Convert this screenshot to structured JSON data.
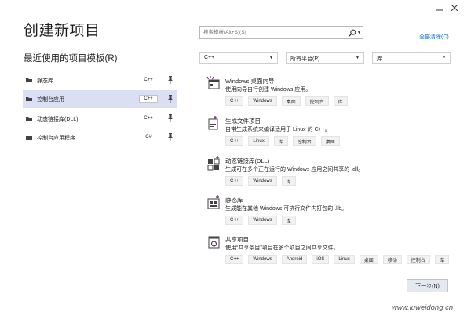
{
  "window": {
    "minimize_icon": "minimize-icon",
    "maximize_icon": "maximize-icon",
    "close_icon": "close-icon"
  },
  "page": {
    "title": "创建新项目"
  },
  "recent": {
    "title": "最近使用的项目模板(R)",
    "items": [
      {
        "name": "静态库",
        "lang": "C++",
        "selected": false,
        "pin_icon": "pin-icon"
      },
      {
        "name": "控制台应用",
        "lang": "C++",
        "selected": true,
        "pin_icon": "pin-icon"
      },
      {
        "name": "动态链接库(DLL)",
        "lang": "C++",
        "selected": false,
        "pin_icon": "pin-icon"
      },
      {
        "name": "控制台应用程序",
        "lang": "C#",
        "selected": false,
        "pin_icon": "pin-icon"
      }
    ]
  },
  "search": {
    "placeholder": "搜索模板(Alt+S)(S)",
    "value": "",
    "icon": "search-icon"
  },
  "clear_all": "全部清除(C)",
  "filters": {
    "language": "C++",
    "platform": "所有平台(P)",
    "project_type": "库"
  },
  "templates": [
    {
      "name": "Windows 桌面向导",
      "desc": "使用向导自行创建 Windows 应用。",
      "tags": [
        "C++",
        "Windows",
        "桌面",
        "控制台",
        "库"
      ],
      "icon": "desktop-wizard-icon"
    },
    {
      "name": "生成文件项目",
      "desc": "自带生成系统来编译适用于 Linux 的 C++。",
      "tags": [
        "C++",
        "Linux",
        "库",
        "控制台",
        "桌面"
      ],
      "icon": "makefile-project-icon"
    },
    {
      "name": "动态链接库(DLL)",
      "desc": "生成可在多个正在运行的 Windows 应用之间共享的 .dll。",
      "tags": [
        "C++",
        "Windows",
        "库"
      ],
      "icon": "dll-icon"
    },
    {
      "name": "静态库",
      "desc": "生成能在其他 Windows 可执行文件内打包的 .lib。",
      "tags": [
        "C++",
        "Windows",
        "库"
      ],
      "icon": "static-library-icon"
    },
    {
      "name": "共享项目",
      "desc": "使用“共享条目”项目在多个项目之间共享文件。",
      "tags": [
        "C++",
        "Windows",
        "Android",
        "iOS",
        "Linux",
        "桌面",
        "移动",
        "控制台",
        "库"
      ],
      "icon": "shared-project-icon"
    }
  ],
  "next_button": "下一步(N)",
  "watermark": "www.luweidong.cn",
  "colors": {
    "accent_link": "#0066cc",
    "selected_row": "#dadff3",
    "vs_purple": "#68217a"
  }
}
